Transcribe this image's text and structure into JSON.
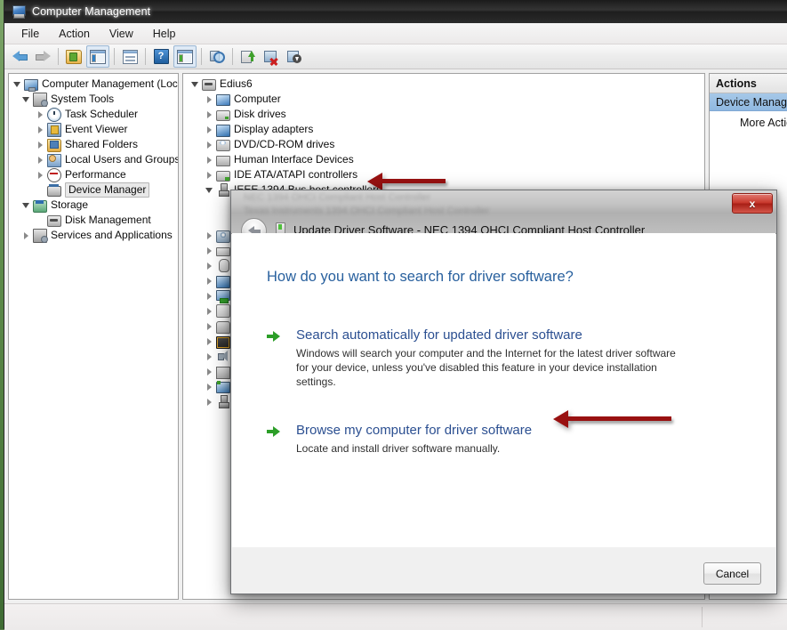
{
  "window": {
    "title": "Computer Management",
    "icon": "computer-management-icon"
  },
  "menu": {
    "items": [
      {
        "label": "File"
      },
      {
        "label": "Action"
      },
      {
        "label": "View"
      },
      {
        "label": "Help"
      }
    ]
  },
  "toolbar": {
    "buttons": [
      {
        "name": "back-button",
        "icon": "back-arrow-icon"
      },
      {
        "name": "forward-button",
        "icon": "forward-arrow-icon"
      },
      {
        "name": "up-folder-button",
        "icon": "folder-up-icon"
      },
      {
        "name": "show-hide-console-tree-button",
        "icon": "console-tree-icon"
      },
      {
        "name": "properties-button",
        "icon": "properties-icon"
      },
      {
        "name": "help-button",
        "icon": "help-icon"
      },
      {
        "name": "show-hide-action-pane-button",
        "icon": "action-pane-icon"
      },
      {
        "name": "scan-for-hardware-changes-button",
        "icon": "scan-hardware-icon"
      },
      {
        "name": "update-driver-software-button",
        "icon": "update-driver-icon"
      },
      {
        "name": "uninstall-device-button",
        "icon": "uninstall-device-icon"
      },
      {
        "name": "disable-device-button",
        "icon": "disable-device-icon"
      }
    ]
  },
  "console_tree": {
    "root": {
      "label": "Computer Management (Local)",
      "icon": "computer-icon",
      "expander": "open"
    },
    "items": [
      {
        "label": "System Tools",
        "icon": "system-tools-icon",
        "expander": "open",
        "indent": 1
      },
      {
        "label": "Task Scheduler",
        "icon": "clock-icon",
        "expander": "closed",
        "indent": 2
      },
      {
        "label": "Event Viewer",
        "icon": "event-viewer-icon",
        "expander": "closed",
        "indent": 2
      },
      {
        "label": "Shared Folders",
        "icon": "shared-folders-icon",
        "expander": "closed",
        "indent": 2
      },
      {
        "label": "Local Users and Groups",
        "icon": "users-icon",
        "expander": "closed",
        "indent": 2
      },
      {
        "label": "Performance",
        "icon": "performance-icon",
        "expander": "closed",
        "indent": 2
      },
      {
        "label": "Device Manager",
        "icon": "device-manager-icon",
        "expander": "none",
        "indent": 2,
        "selected": true
      },
      {
        "label": "Storage",
        "icon": "storage-icon",
        "expander": "open",
        "indent": 1
      },
      {
        "label": "Disk Management",
        "icon": "disk-management-icon",
        "expander": "none",
        "indent": 2
      },
      {
        "label": "Services and Applications",
        "icon": "services-icon",
        "expander": "closed",
        "indent": 1
      }
    ]
  },
  "device_tree": {
    "root": {
      "label": "Edius6",
      "icon": "computer-node-icon",
      "expander": "open"
    },
    "items": [
      {
        "label": "Computer",
        "icon": "computer-category-icon",
        "expander": "closed"
      },
      {
        "label": "Disk drives",
        "icon": "disk-drive-icon",
        "expander": "closed"
      },
      {
        "label": "Display adapters",
        "icon": "display-adapter-icon",
        "expander": "closed"
      },
      {
        "label": "DVD/CD-ROM drives",
        "icon": "dvd-drive-icon",
        "expander": "closed"
      },
      {
        "label": "Human Interface Devices",
        "icon": "hid-icon",
        "expander": "closed"
      },
      {
        "label": "IDE ATA/ATAPI controllers",
        "icon": "ide-controller-icon",
        "expander": "closed"
      },
      {
        "label": "IEEE 1394 Bus host controllers",
        "icon": "ieee1394-icon",
        "expander": "open"
      }
    ],
    "obscured_items": [
      {
        "icon": "imaging-device-icon",
        "expander": "closed"
      },
      {
        "icon": "keyboard-icon",
        "expander": "closed"
      },
      {
        "icon": "mouse-icon",
        "expander": "closed"
      },
      {
        "icon": "monitor-icon",
        "expander": "closed"
      },
      {
        "icon": "network-adapter-icon",
        "expander": "closed"
      },
      {
        "icon": "other-device-icon",
        "expander": "closed"
      },
      {
        "icon": "port-icon",
        "expander": "closed"
      },
      {
        "icon": "processor-icon",
        "expander": "closed"
      },
      {
        "icon": "sound-device-icon",
        "expander": "closed"
      },
      {
        "icon": "system-device-icon",
        "expander": "closed"
      },
      {
        "icon": "universal-serial-bus-icon",
        "expander": "closed"
      },
      {
        "icon": "usb-controller-icon",
        "expander": "closed"
      }
    ]
  },
  "actions_pane": {
    "header": "Actions",
    "selected_scope": "Device Manage",
    "more_actions": "More Actio"
  },
  "dialog": {
    "title": "Update Driver Software - NEC 1394 OHCI Compliant Host Controller",
    "close_label": "x",
    "back_label": "back-arrow",
    "heading": "How do you want to search for driver software?",
    "options": [
      {
        "title": "Search automatically for updated driver software",
        "description": "Windows will search your computer and the Internet for the latest driver software for your device, unless you've disabled this feature in your device installation settings."
      },
      {
        "title": "Browse my computer for driver software",
        "description": "Locate and install driver software manually."
      }
    ],
    "cancel_label": "Cancel"
  },
  "annotations": {
    "arrow_1": "points-to-ieee-1394-bus-host-controllers",
    "arrow_2": "points-to-browse-my-computer-option"
  },
  "colors": {
    "accent_blue": "#2b4f91",
    "heading_blue": "#28609e",
    "arrow_green": "#2c9e28",
    "annotation_red": "#991111",
    "selection_blue": "#a6c8e8"
  }
}
